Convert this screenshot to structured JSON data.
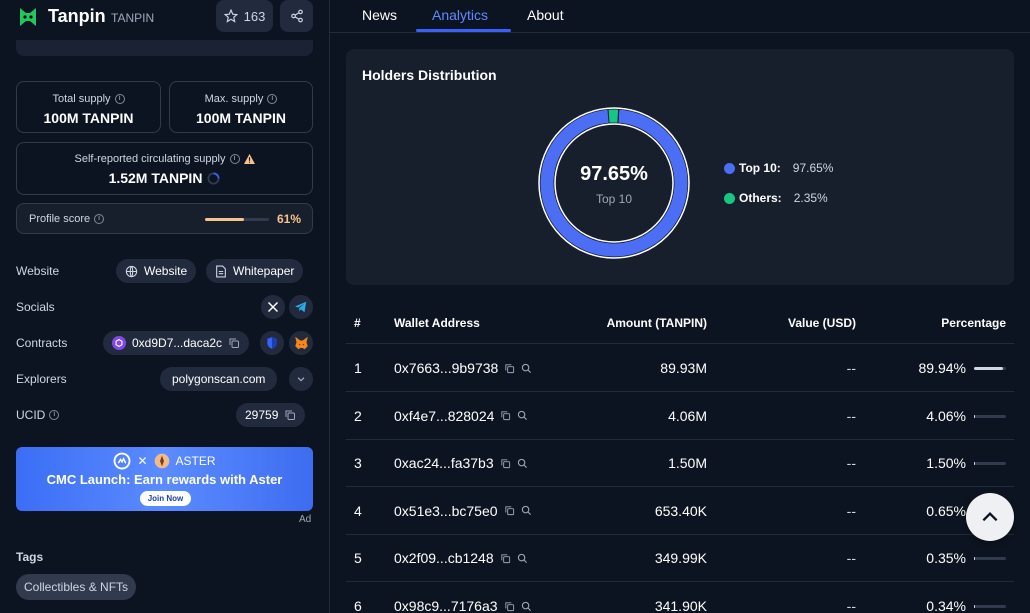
{
  "coin": {
    "name": "Tanpin",
    "symbol": "TANPIN",
    "watchlist_count": "163"
  },
  "supply": {
    "total_label": "Total supply",
    "total_value": "100M TANPIN",
    "max_label": "Max. supply",
    "max_value": "100M TANPIN",
    "circ_label": "Self-reported circulating supply",
    "circ_value": "1.52M TANPIN"
  },
  "profile_score": {
    "label": "Profile score",
    "value": "61%",
    "fraction": 0.61
  },
  "links": {
    "website_label": "Website",
    "website_btn": "Website",
    "whitepaper_btn": "Whitepaper",
    "socials_label": "Socials",
    "contracts_label": "Contracts",
    "contract_addr": "0xd9D7...daca2c",
    "explorers_label": "Explorers",
    "explorer": "polygonscan.com",
    "ucid_label": "UCID",
    "ucid": "29759"
  },
  "banner": {
    "brand": "ASTER",
    "title": "CMC Launch: Earn rewards with Aster",
    "button": "Join Now",
    "ad_label": "Ad"
  },
  "tags": {
    "heading": "Tags",
    "items": [
      "Collectibles & NFTs"
    ]
  },
  "tabs": [
    "News",
    "Analytics",
    "About"
  ],
  "holders": {
    "title": "Holders Distribution",
    "center_value": "97.65%",
    "center_label": "Top 10",
    "legend": [
      {
        "label": "Top 10:",
        "value": "97.65%",
        "color": "#4b6ef5"
      },
      {
        "label": "Others:",
        "value": "2.35%",
        "color": "#16c784"
      }
    ]
  },
  "chart_data": {
    "type": "pie",
    "categories": [
      "Top 10",
      "Others"
    ],
    "values": [
      97.65,
      2.35
    ],
    "colors": [
      "#4b6ef5",
      "#16c784"
    ]
  },
  "table": {
    "headers": [
      "#",
      "Wallet Address",
      "Amount (TANPIN)",
      "Value (USD)",
      "Percentage"
    ],
    "rows": [
      {
        "idx": "1",
        "addr": "0x7663...9b9738",
        "amount": "89.93M",
        "value": "--",
        "pct": "89.94%",
        "frac": 0.8994
      },
      {
        "idx": "2",
        "addr": "0xf4e7...828024",
        "amount": "4.06M",
        "value": "--",
        "pct": "4.06%",
        "frac": 0.0406
      },
      {
        "idx": "3",
        "addr": "0xac24...fa37b3",
        "amount": "1.50M",
        "value": "--",
        "pct": "1.50%",
        "frac": 0.015
      },
      {
        "idx": "4",
        "addr": "0x51e3...bc75e0",
        "amount": "653.40K",
        "value": "--",
        "pct": "0.65%",
        "frac": 0.0065
      },
      {
        "idx": "5",
        "addr": "0x2f09...cb1248",
        "amount": "349.99K",
        "value": "--",
        "pct": "0.35%",
        "frac": 0.0035
      },
      {
        "idx": "6",
        "addr": "0x98c9...7176a3",
        "amount": "341.90K",
        "value": "--",
        "pct": "0.34%",
        "frac": 0.0034
      }
    ]
  }
}
